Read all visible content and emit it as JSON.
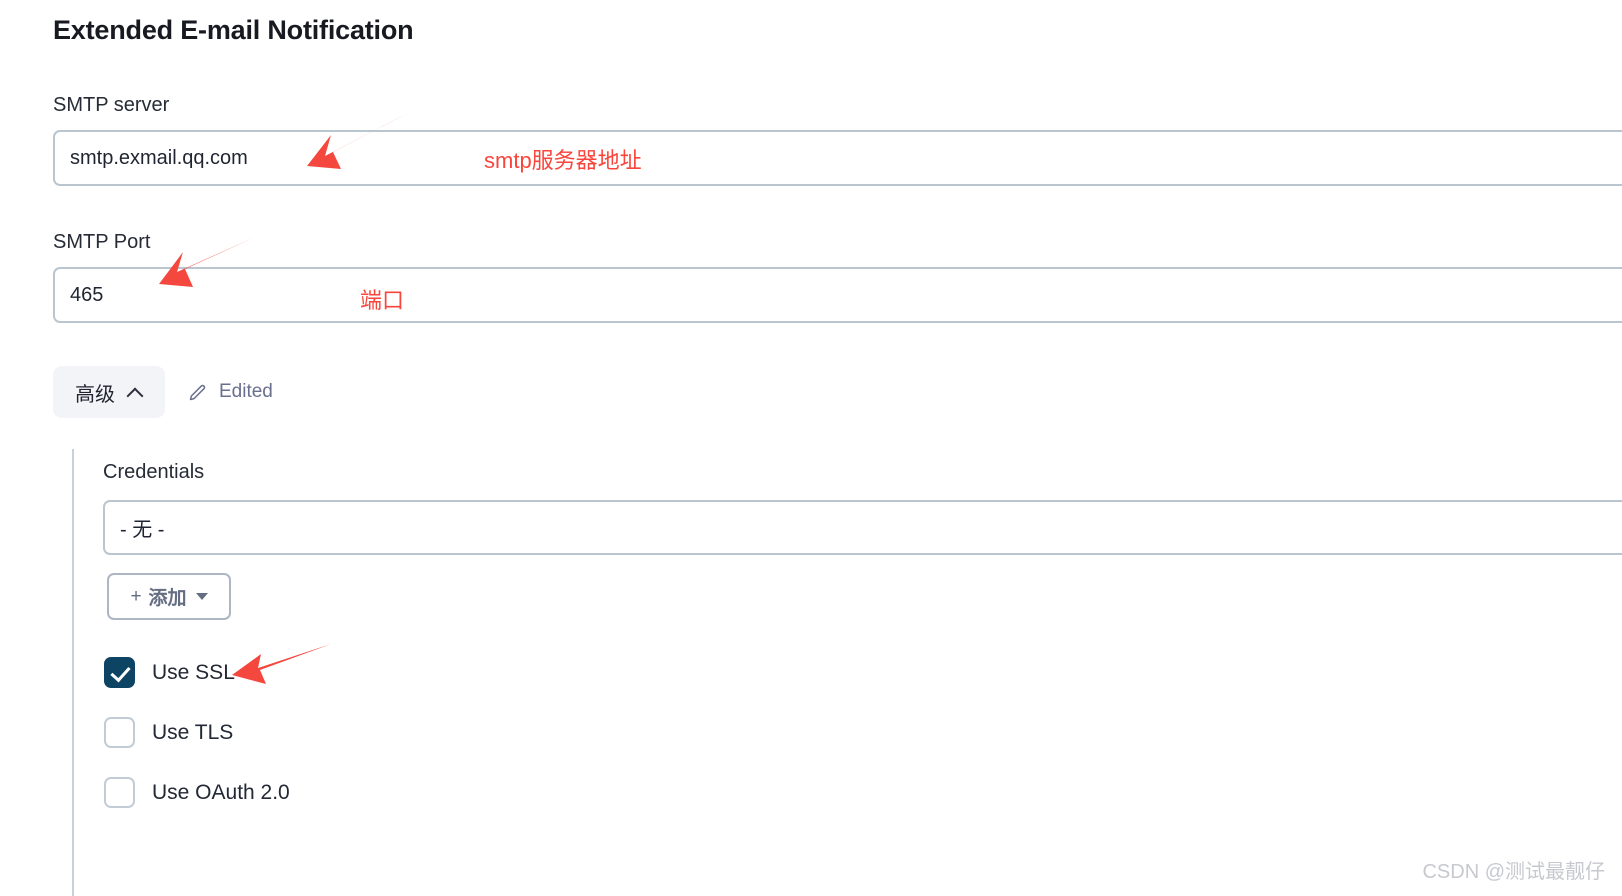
{
  "page": {
    "title": "Extended E-mail Notification"
  },
  "fields": {
    "smtp_server": {
      "label": "SMTP server",
      "value": "smtp.exmail.qq.com",
      "placeholder": ""
    },
    "smtp_port": {
      "label": "SMTP Port",
      "value": "465",
      "placeholder": ""
    }
  },
  "advanced": {
    "button_label": "高级",
    "chevron_icon": "chevron-up-icon",
    "edited_label": "Edited",
    "edited_icon": "pencil-icon",
    "credentials": {
      "label": "Credentials",
      "selected_value": "- 无 -",
      "add_button_plus": "+",
      "add_button_label": "添加",
      "add_button_caret_icon": "caret-down-icon"
    },
    "checkboxes": [
      {
        "label": "Use SSL",
        "checked": true
      },
      {
        "label": "Use TLS",
        "checked": false
      },
      {
        "label": "Use OAuth 2.0",
        "checked": false
      }
    ]
  },
  "annotations": {
    "smtp_server_note": "smtp服务器地址",
    "smtp_port_note": "端口",
    "arrow_icon": "red-arrow-icon",
    "accent_red": "#f9453c"
  },
  "watermark": {
    "text": "CSDN @测试最靓仔"
  },
  "colors": {
    "title": "#171a20",
    "input_border": "#b9c6d0",
    "checkbox_checked": "#0e4463",
    "advanced_button_bg": "#f3f4f7",
    "edited_text": "#6a6f8c",
    "add_button_text": "#646d82"
  }
}
